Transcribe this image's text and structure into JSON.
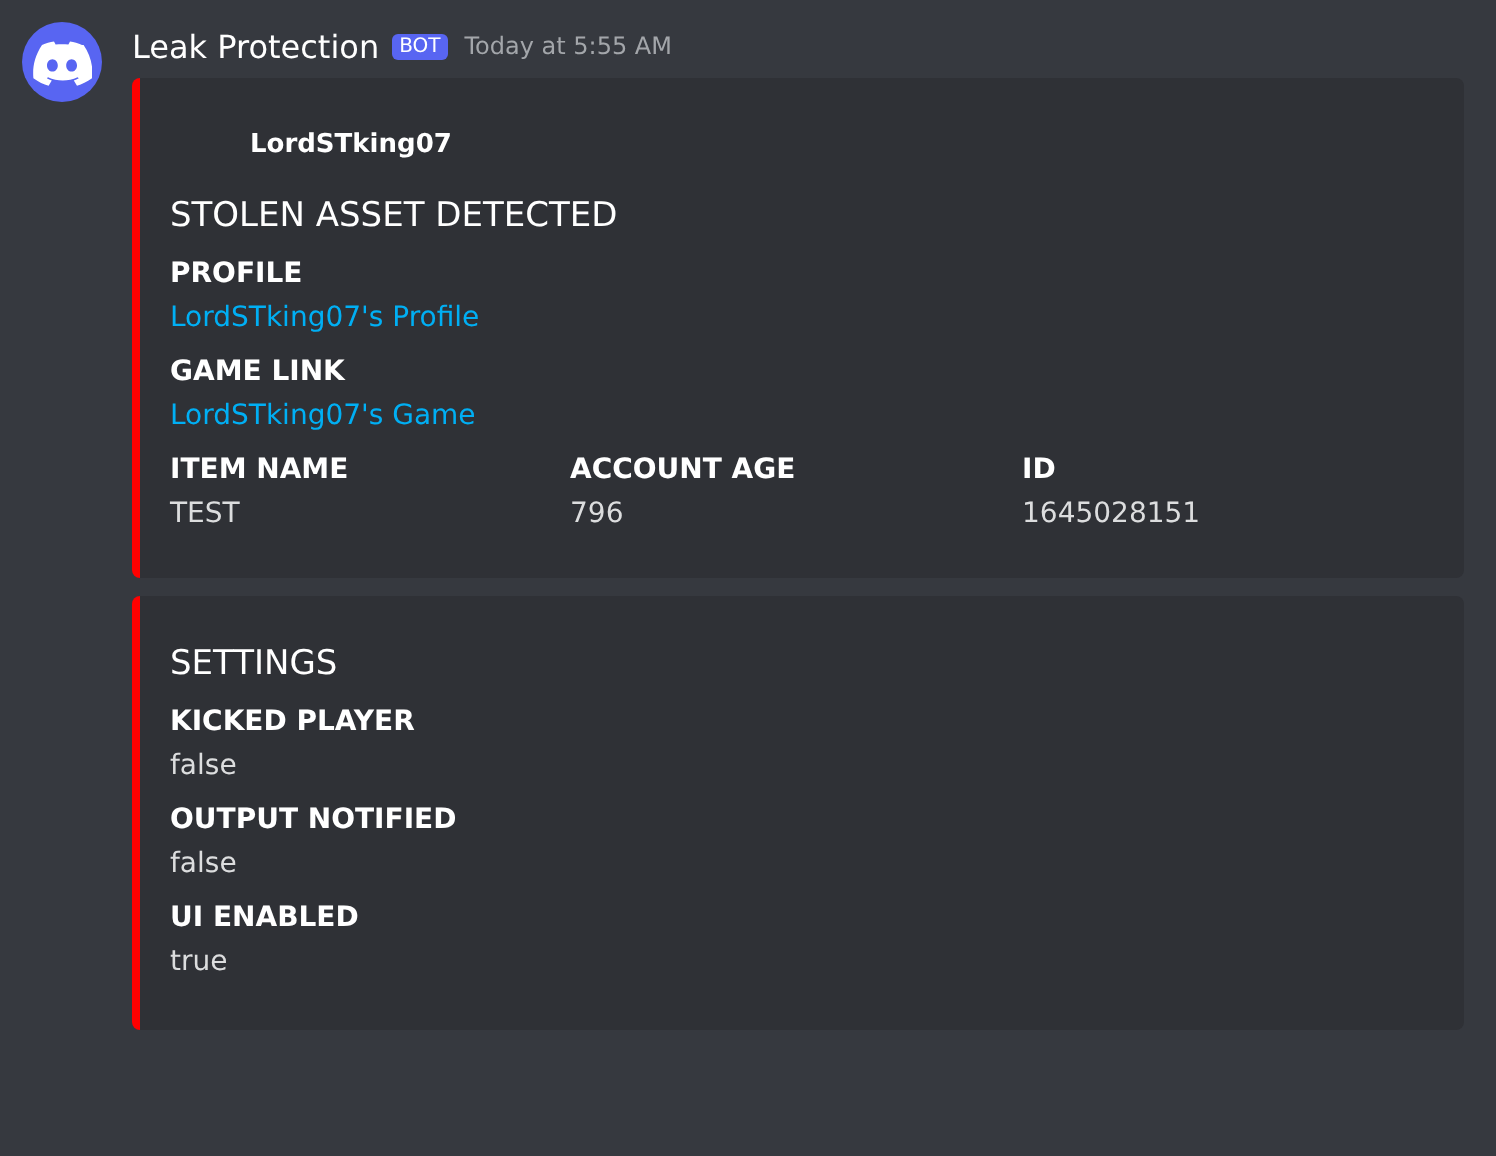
{
  "message": {
    "author": "Leak Protection",
    "badge": "BOT",
    "timestamp": "Today at 5:55 AM"
  },
  "embeds": [
    {
      "color": "#ff0000",
      "author": "LordSTking07",
      "title": "STOLEN ASSET DETECTED",
      "fields": [
        {
          "name": "PROFILE",
          "value": "LordSTking07's Profile",
          "inline": false,
          "link": true
        },
        {
          "name": "GAME LINK",
          "value": "LordSTking07's Game",
          "inline": false,
          "link": true
        },
        {
          "name": "ITEM NAME",
          "value": "TEST",
          "inline": true,
          "link": false
        },
        {
          "name": "ACCOUNT AGE",
          "value": "796",
          "inline": true,
          "link": false
        },
        {
          "name": "ID",
          "value": "1645028151",
          "inline": true,
          "link": false
        }
      ]
    },
    {
      "color": "#ff0000",
      "title": "SETTINGS",
      "fields": [
        {
          "name": "KICKED PLAYER",
          "value": "false",
          "inline": false,
          "link": false
        },
        {
          "name": "OUTPUT NOTIFIED",
          "value": "false",
          "inline": false,
          "link": false
        },
        {
          "name": "UI ENABLED",
          "value": "true",
          "inline": false,
          "link": false
        }
      ]
    }
  ]
}
